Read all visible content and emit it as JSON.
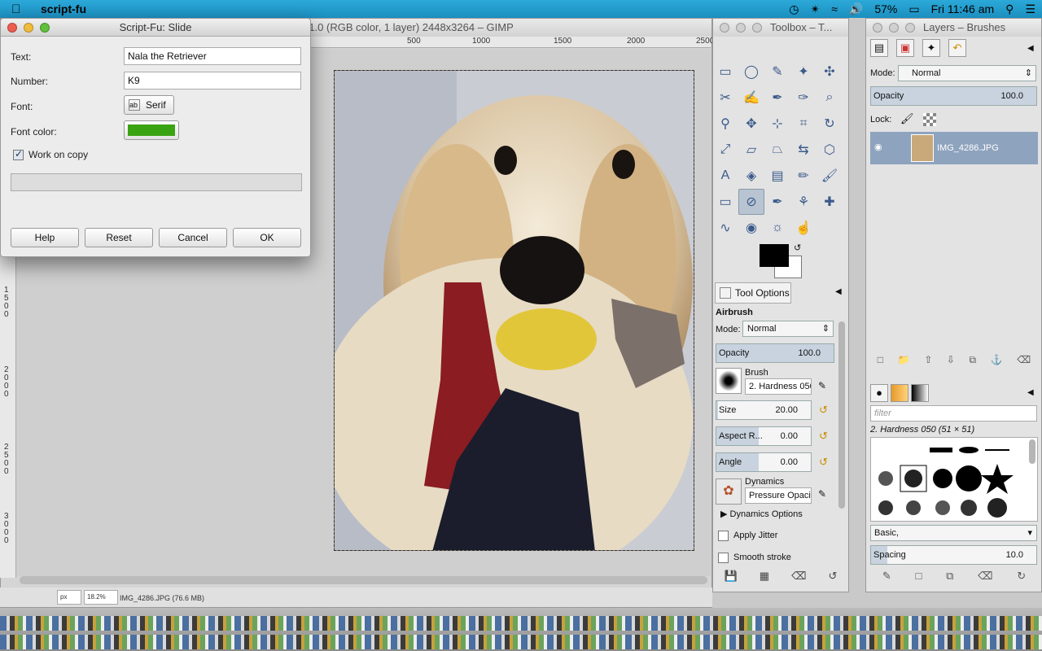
{
  "menubar": {
    "apple": "",
    "app_name": "script-fu",
    "battery": "57%",
    "clock": "Fri 11:46 am"
  },
  "image_window": {
    "title": "[IMG_4286] (imported)-1.0 (RGB color, 1 layer) 2448x3264 – GIMP",
    "ruler_top": [
      "500",
      "1000",
      "1500",
      "2000",
      "2500"
    ],
    "ruler_left": [
      "1500",
      "2000",
      "2500",
      "3000"
    ],
    "status": {
      "unit": "px",
      "zoom": "18.2%",
      "file": "IMG_4286.JPG (76.6 MB)"
    }
  },
  "dialog": {
    "title": "Script-Fu: Slide",
    "text_label": "Text:",
    "text_value": "Nala the Retriever",
    "number_label": "Number:",
    "number_value": "K9",
    "font_label": "Font:",
    "font_value": "Serif",
    "font_color_label": "Font color:",
    "font_color": "#3aa311",
    "work_on_copy": "Work on copy",
    "buttons": {
      "help": "Help",
      "reset": "Reset",
      "cancel": "Cancel",
      "ok": "OK"
    }
  },
  "toolbox": {
    "title": "Toolbox – T...",
    "tool_options_tab": "Tool Options",
    "tool_name": "Airbrush",
    "mode_label": "Mode:",
    "mode_value": "Normal",
    "opacity_label": "Opacity",
    "opacity_value": "100.0",
    "brush_label": "Brush",
    "brush_value": "2. Hardness 050",
    "size_label": "Size",
    "size_value": "20.00",
    "aspect_label": "Aspect R...",
    "aspect_value": "0.00",
    "angle_label": "Angle",
    "angle_value": "0.00",
    "dynamics_label": "Dynamics",
    "dynamics_value": "Pressure Opacit",
    "dynamics_options": "Dynamics Options",
    "apply_jitter": "Apply Jitter",
    "smooth_stroke": "Smooth stroke",
    "tools": [
      "rect-select",
      "ellipse-select",
      "free-select",
      "fuzzy-select",
      "select-by-color",
      "scissors",
      "foreground-select",
      "paths",
      "color-picker",
      "zoom",
      "measure",
      "move",
      "align",
      "crop",
      "rotate",
      "scale",
      "shear",
      "perspective",
      "flip",
      "cage",
      "text",
      "bucket-fill",
      "blend",
      "pencil",
      "paintbrush",
      "eraser",
      "airbrush",
      "ink",
      "clone",
      "heal",
      "smudge",
      "blur",
      "dodge",
      "smudge-finger"
    ]
  },
  "layers": {
    "title": "Layers – Brushes",
    "mode_label": "Mode:",
    "mode_value": "Normal",
    "opacity_label": "Opacity",
    "opacity_value": "100.0",
    "lock_label": "Lock:",
    "layer_name": "IMG_4286.JPG",
    "brush_filter": "filter",
    "brush_selected": "2. Hardness 050 (51 × 51)",
    "brush_set": "Basic,",
    "spacing_label": "Spacing",
    "spacing_value": "10.0"
  }
}
